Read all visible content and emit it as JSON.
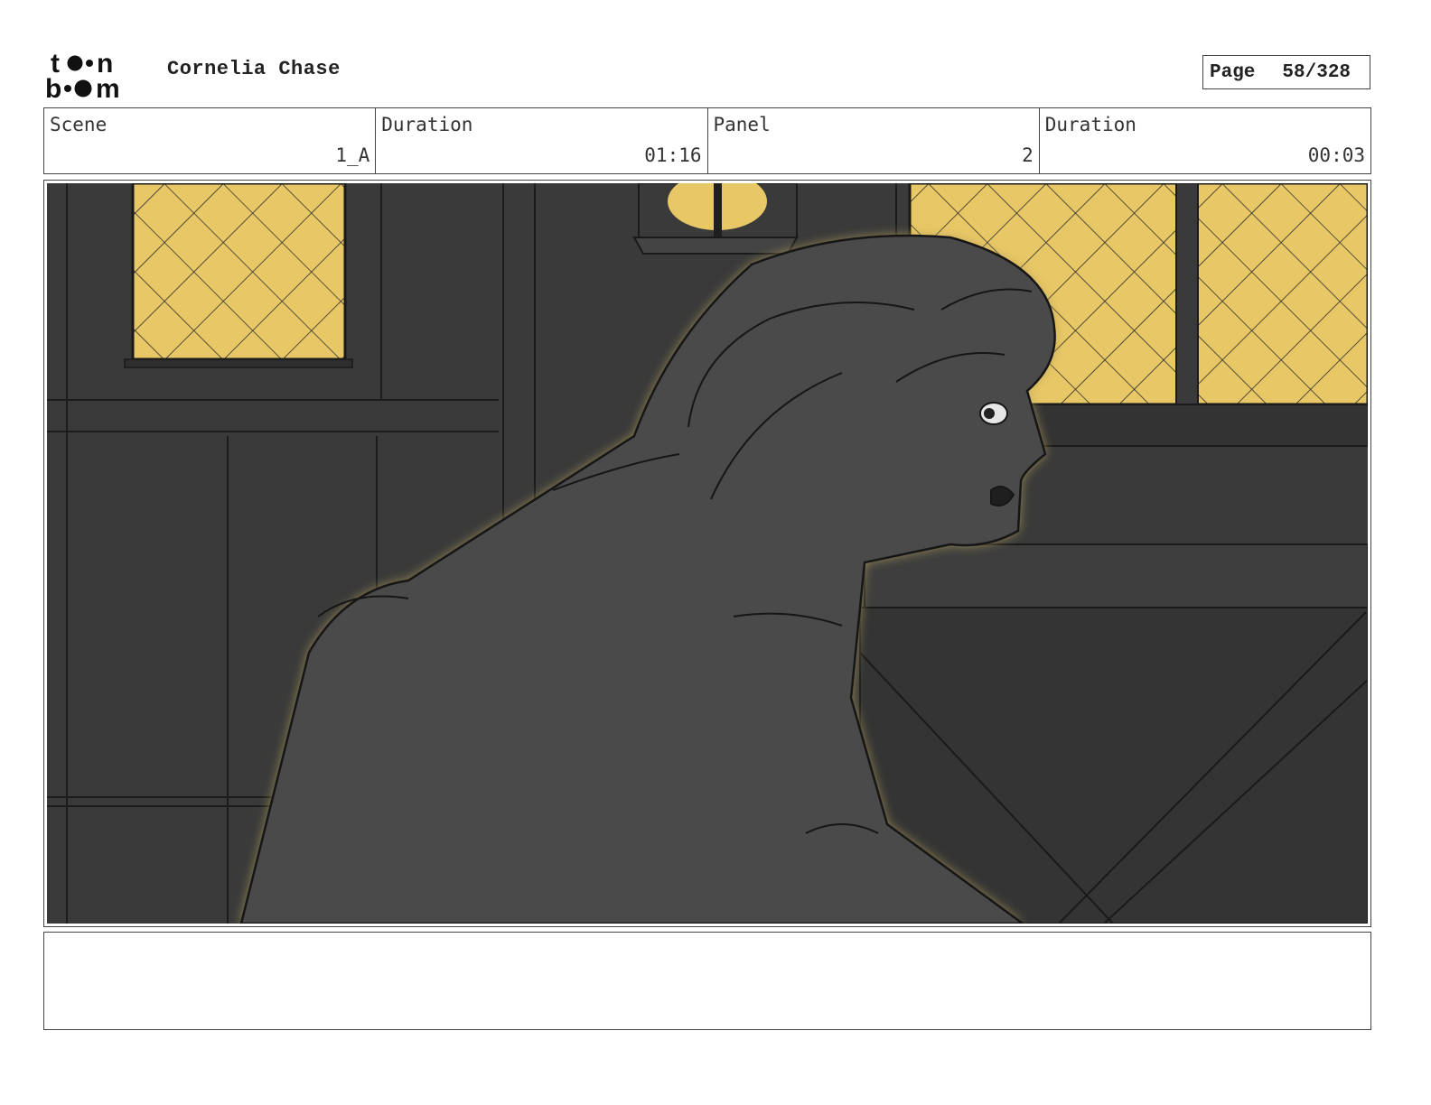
{
  "header": {
    "logo_text": "toon boom",
    "project_title": "Cornelia Chase",
    "page_label": "Page",
    "page_number": "58/328"
  },
  "info": {
    "scene_label": "Scene",
    "scene_value": "1_A",
    "scene_duration_label": "Duration",
    "scene_duration_value": "01:16",
    "panel_label": "Panel",
    "panel_value": "2",
    "panel_duration_label": "Duration",
    "panel_duration_value": "00:03"
  },
  "panel": {
    "colors": {
      "wall": "#3a3a3a",
      "window_glow": "#e8c766",
      "figure": "#4a4a4a",
      "rim_light": "#b8a35a"
    }
  },
  "notes": {
    "text": ""
  }
}
